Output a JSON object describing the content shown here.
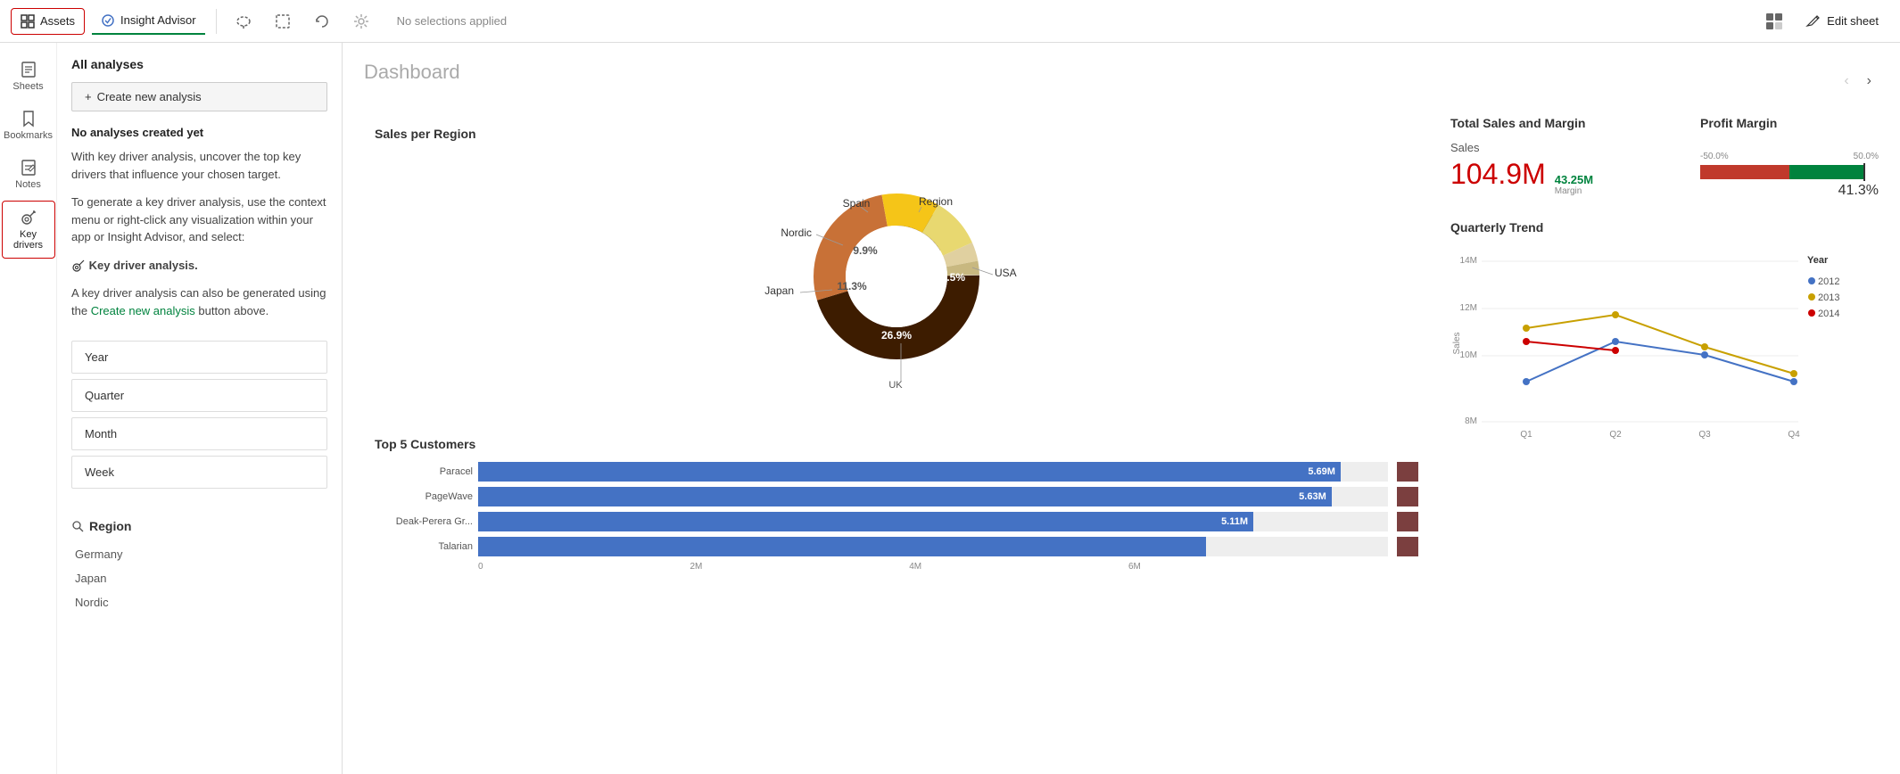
{
  "topNav": {
    "assets_label": "Assets",
    "insight_advisor_label": "Insight Advisor",
    "no_selections_label": "No selections applied",
    "edit_sheet_label": "Edit sheet"
  },
  "sidebar": {
    "items": [
      {
        "label": "Sheets",
        "icon": "sheets"
      },
      {
        "label": "Bookmarks",
        "icon": "bookmarks"
      },
      {
        "label": "Notes",
        "icon": "notes"
      },
      {
        "label": "Key drivers",
        "icon": "key-drivers",
        "active": true
      }
    ]
  },
  "analysesPanel": {
    "title": "All analyses",
    "create_btn": "Create new analysis",
    "no_analyses": "No analyses created yet",
    "text1": "With key driver analysis, uncover the top key drivers that influence your chosen target.",
    "text2": "To generate a key driver analysis, use the context menu or right-click any visualization within your app or Insight Advisor, and select:",
    "key_driver_label": "Key driver analysis.",
    "text3": "A key driver analysis can also be generated using the",
    "create_new_link": "Create new analysis",
    "text3_end": "button above."
  },
  "filters": {
    "items": [
      "Year",
      "Quarter",
      "Month",
      "Week"
    ],
    "region_title": "Region",
    "region_items": [
      "Germany",
      "Japan",
      "Nordic"
    ]
  },
  "dashboard": {
    "title": "Dashboard",
    "sales_region_title": "Sales per Region",
    "donut": {
      "segments": [
        {
          "label": "USA",
          "value": 45.5,
          "color": "#3d1c00"
        },
        {
          "label": "UK",
          "value": 26.9,
          "color": "#c87137"
        },
        {
          "label": "Japan",
          "value": 11.3,
          "color": "#f5c518"
        },
        {
          "label": "Nordic",
          "value": 9.9,
          "color": "#f0e68c"
        },
        {
          "label": "Spain",
          "value": 3.7,
          "color": "#e8d5a0"
        },
        {
          "label": "Region",
          "value": 2.7,
          "color": "#d4b483"
        }
      ],
      "labels": {
        "usa": "USA",
        "uk": "UK",
        "japan": "Japan",
        "nordic": "Nordic",
        "spain": "Spain",
        "region": "Region",
        "pct_usa": "45.5%",
        "pct_uk": "26.9%",
        "pct_japan": "11.3%",
        "pct_nordic": "9.9%"
      }
    },
    "top5_title": "Top 5 Customers",
    "customers": [
      {
        "name": "Paracel",
        "value": 5.69,
        "label": "5.69M",
        "pct": 94.8
      },
      {
        "name": "PageWave",
        "value": 5.63,
        "label": "5.63M",
        "pct": 93.8
      },
      {
        "name": "Deak-Perera Gr...",
        "value": 5.11,
        "label": "5.11M",
        "pct": 85.2
      },
      {
        "name": "Talarian",
        "value": 4.8,
        "label": "",
        "pct": 80.0
      }
    ],
    "bar_axis": [
      "0",
      "2M",
      "4M",
      "6M"
    ],
    "total_sales_title": "Total Sales and Margin",
    "sales_label": "Sales",
    "sales_value": "104.9M",
    "margin_value": "43.25M",
    "margin_label": "Margin",
    "profit_title": "Profit Margin",
    "profit_min": "-50.0%",
    "profit_max": "50.0%",
    "profit_pct": "41.3%",
    "quarterly_title": "Quarterly Trend",
    "quarterly_y_labels": [
      "14M",
      "12M",
      "10M",
      "8M"
    ],
    "quarterly_x_labels": [
      "Q1",
      "Q2",
      "Q3",
      "Q4"
    ],
    "quarterly_y_axis": "Sales",
    "legend": {
      "title": "Year",
      "items": [
        {
          "label": "2012",
          "color": "#4472c4"
        },
        {
          "label": "2013",
          "color": "#c8a000"
        },
        {
          "label": "2014",
          "color": "#c00"
        }
      ]
    }
  }
}
